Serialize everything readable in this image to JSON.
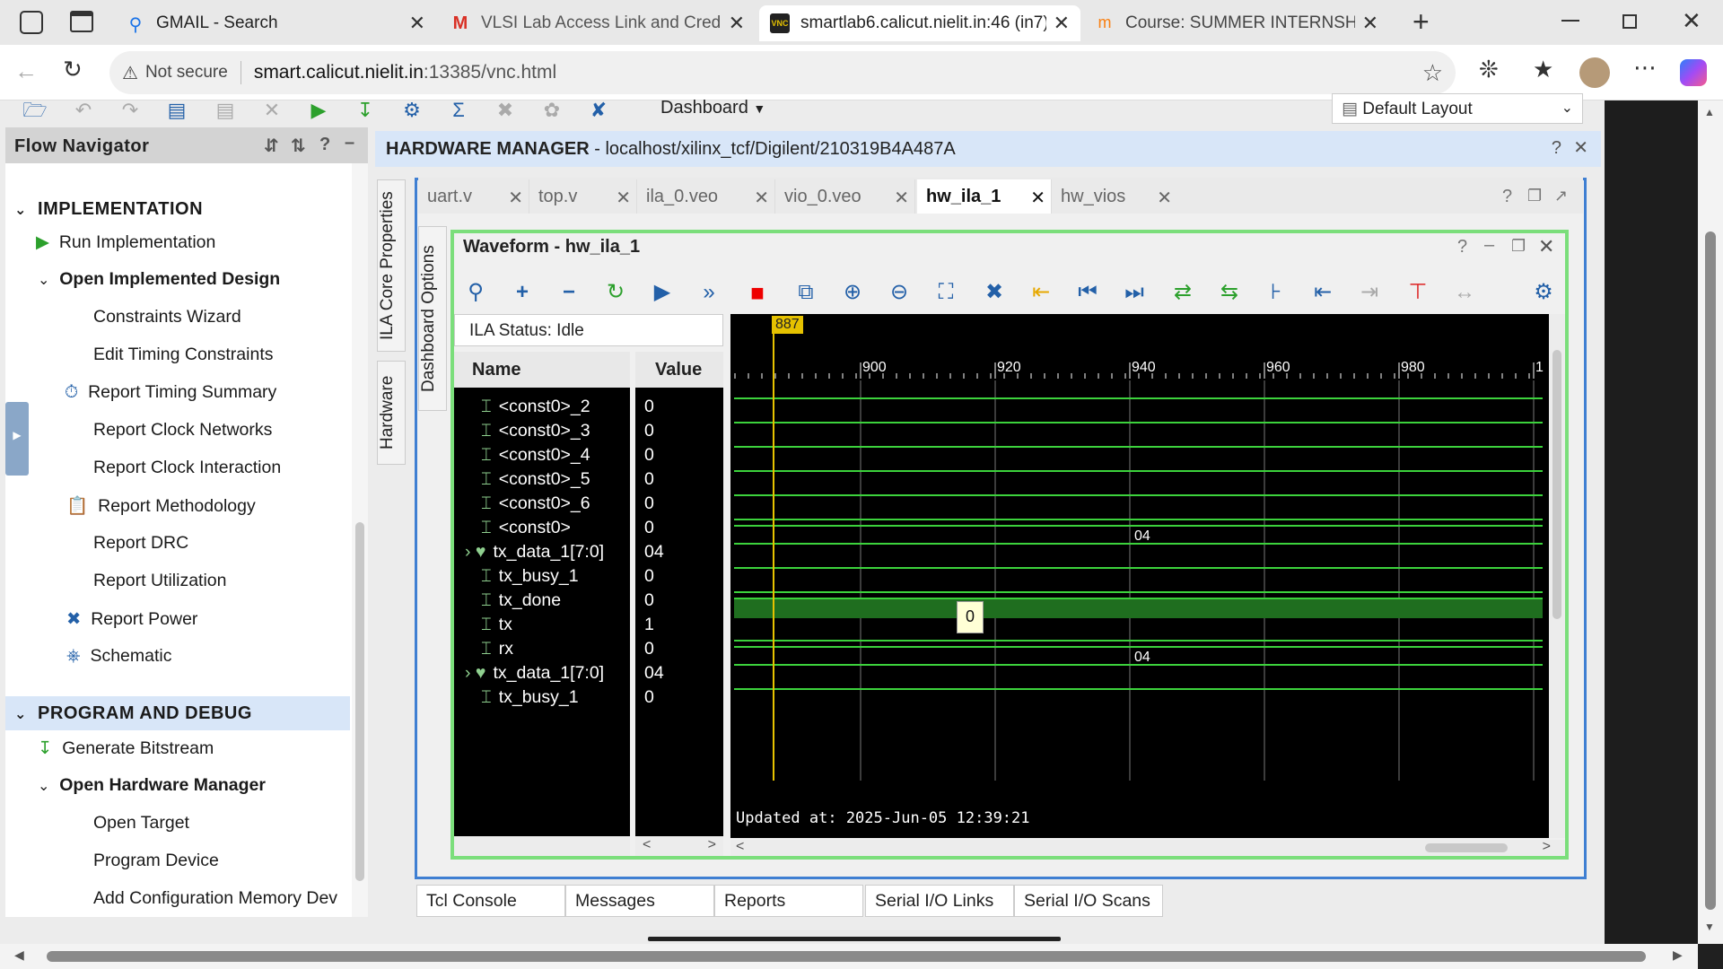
{
  "browser": {
    "tabs": [
      {
        "label": "GMAIL - Search",
        "icon": "search-icon"
      },
      {
        "label": "VLSI Lab Access Link and Credent",
        "icon": "gmail-icon"
      },
      {
        "label": "smartlab6.calicut.nielit.in:46 (in7)",
        "icon": "vnc-icon",
        "active": true
      },
      {
        "label": "Course: SUMMER INTERNSHIP ON",
        "icon": "moodle-icon"
      }
    ],
    "security_label": "Not secure",
    "url_host": "smart.calicut.nielit.in",
    "url_rest": ":13385/vnc.html"
  },
  "vivado": {
    "toolbar_dashboard": "Dashboard",
    "layout_select": "Default Layout",
    "flow_navigator": {
      "title": "Flow Navigator",
      "impl_section": "IMPLEMENTATION",
      "run_impl": "Run Implementation",
      "open_impl": "Open Implemented Design",
      "impl_items": [
        "Constraints Wizard",
        "Edit Timing Constraints",
        "Report Timing Summary",
        "Report Clock Networks",
        "Report Clock Interaction",
        "Report Methodology",
        "Report DRC",
        "Report Utilization",
        "Report Power",
        "Schematic"
      ],
      "pd_section": "PROGRAM AND DEBUG",
      "gen_bitstream": "Generate Bitstream",
      "open_hw": "Open Hardware Manager",
      "hw_items": [
        "Open Target",
        "Program Device",
        "Add Configuration Memory Dev"
      ]
    },
    "hw_manager": {
      "title_bold": "HARDWARE MANAGER",
      "title_rest": " - localhost/xilinx_tcf/Digilent/210319B4A487A",
      "side_tabs": [
        "ILA Core Properties",
        "Hardware",
        "Dashboard Options"
      ],
      "tabs": [
        "uart.v",
        "top.v",
        "ila_0.veo",
        "vio_0.veo",
        "hw_ila_1",
        "hw_vios"
      ],
      "active_tab": "hw_ila_1"
    },
    "waveform": {
      "title": "Waveform - hw_ila_1",
      "ila_status": "ILA Status:  Idle",
      "col_name": "Name",
      "col_value": "Value",
      "signals": [
        {
          "name": "<const0>_2",
          "value": "0",
          "bus": false
        },
        {
          "name": "<const0>_3",
          "value": "0",
          "bus": false
        },
        {
          "name": "<const0>_4",
          "value": "0",
          "bus": false
        },
        {
          "name": "<const0>_5",
          "value": "0",
          "bus": false
        },
        {
          "name": "<const0>_6",
          "value": "0",
          "bus": false
        },
        {
          "name": "<const0>",
          "value": "0",
          "bus": false
        },
        {
          "name": "tx_data_1[7:0]",
          "value": "04",
          "bus": true
        },
        {
          "name": "tx_busy_1",
          "value": "0",
          "bus": false
        },
        {
          "name": "tx_done",
          "value": "0",
          "bus": false
        },
        {
          "name": "tx",
          "value": "1",
          "bus": false
        },
        {
          "name": "rx",
          "value": "0",
          "bus": false
        },
        {
          "name": "tx_data_1[7:0]",
          "value": "04",
          "bus": true
        },
        {
          "name": "tx_busy_1",
          "value": "0",
          "bus": false
        }
      ],
      "cursor_label": "887",
      "ticks": [
        "900",
        "920",
        "940",
        "960",
        "980",
        "1"
      ],
      "bus_labels": [
        "04",
        "04"
      ],
      "tooltip": "0",
      "updated": "Updated at: 2025-Jun-05 12:39:21"
    },
    "bottom_tabs": [
      "Tcl Console",
      "Messages",
      "Reports",
      "Serial I/O Links",
      "Serial I/O Scans"
    ]
  }
}
